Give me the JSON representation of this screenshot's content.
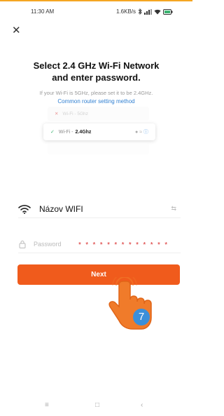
{
  "colors": {
    "accent": "#f05b1c",
    "link": "#2f7fd1",
    "annotation_stars": "#d92b2b",
    "step_badge": "#3b8fd9",
    "topline": "#f5a623"
  },
  "status_bar": {
    "time": "11:30 AM",
    "network_speed": "1.6KB/s",
    "icons": [
      "bluetooth-icon",
      "signal-icon",
      "wifi-icon",
      "battery-icon"
    ]
  },
  "header": {
    "close_icon": "close-icon"
  },
  "title": {
    "line1": "Select 2.4 GHz Wi-Fi Network",
    "line2": "and enter password."
  },
  "subtitle": "If your Wi-Fi is 5GHz, please set it to be 2.4GHz.",
  "router_link": "Common router setting method",
  "illustration": {
    "bad_network": "Wi-Fi - 5Ghz",
    "good_prefix": "Wi-Fi - ",
    "good_band": "2.4Ghz"
  },
  "form": {
    "ssid_value": "Názov WIFI",
    "password_placeholder": "Password",
    "password_annotation": "* * * * * * * * * * * * *",
    "next_label": "Next"
  },
  "annotation": {
    "step_number": "7"
  },
  "navbar": {
    "menu_glyph": "≡",
    "home_glyph": "□",
    "back_glyph": "‹"
  }
}
